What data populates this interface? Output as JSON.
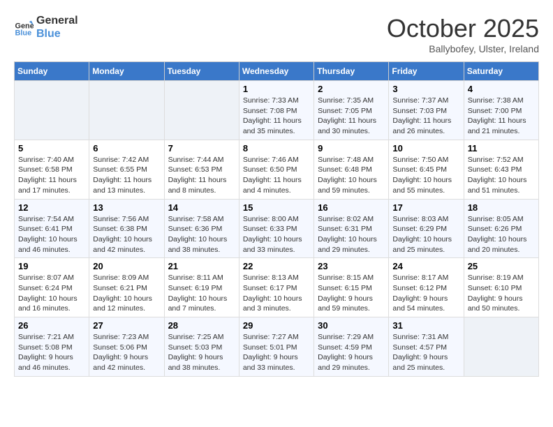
{
  "logo": {
    "line1": "General",
    "line2": "Blue"
  },
  "title": "October 2025",
  "location": "Ballybofey, Ulster, Ireland",
  "weekdays": [
    "Sunday",
    "Monday",
    "Tuesday",
    "Wednesday",
    "Thursday",
    "Friday",
    "Saturday"
  ],
  "rows": [
    [
      {
        "day": "",
        "info": ""
      },
      {
        "day": "",
        "info": ""
      },
      {
        "day": "",
        "info": ""
      },
      {
        "day": "1",
        "info": "Sunrise: 7:33 AM\nSunset: 7:08 PM\nDaylight: 11 hours\nand 35 minutes."
      },
      {
        "day": "2",
        "info": "Sunrise: 7:35 AM\nSunset: 7:05 PM\nDaylight: 11 hours\nand 30 minutes."
      },
      {
        "day": "3",
        "info": "Sunrise: 7:37 AM\nSunset: 7:03 PM\nDaylight: 11 hours\nand 26 minutes."
      },
      {
        "day": "4",
        "info": "Sunrise: 7:38 AM\nSunset: 7:00 PM\nDaylight: 11 hours\nand 21 minutes."
      }
    ],
    [
      {
        "day": "5",
        "info": "Sunrise: 7:40 AM\nSunset: 6:58 PM\nDaylight: 11 hours\nand 17 minutes."
      },
      {
        "day": "6",
        "info": "Sunrise: 7:42 AM\nSunset: 6:55 PM\nDaylight: 11 hours\nand 13 minutes."
      },
      {
        "day": "7",
        "info": "Sunrise: 7:44 AM\nSunset: 6:53 PM\nDaylight: 11 hours\nand 8 minutes."
      },
      {
        "day": "8",
        "info": "Sunrise: 7:46 AM\nSunset: 6:50 PM\nDaylight: 11 hours\nand 4 minutes."
      },
      {
        "day": "9",
        "info": "Sunrise: 7:48 AM\nSunset: 6:48 PM\nDaylight: 10 hours\nand 59 minutes."
      },
      {
        "day": "10",
        "info": "Sunrise: 7:50 AM\nSunset: 6:45 PM\nDaylight: 10 hours\nand 55 minutes."
      },
      {
        "day": "11",
        "info": "Sunrise: 7:52 AM\nSunset: 6:43 PM\nDaylight: 10 hours\nand 51 minutes."
      }
    ],
    [
      {
        "day": "12",
        "info": "Sunrise: 7:54 AM\nSunset: 6:41 PM\nDaylight: 10 hours\nand 46 minutes."
      },
      {
        "day": "13",
        "info": "Sunrise: 7:56 AM\nSunset: 6:38 PM\nDaylight: 10 hours\nand 42 minutes."
      },
      {
        "day": "14",
        "info": "Sunrise: 7:58 AM\nSunset: 6:36 PM\nDaylight: 10 hours\nand 38 minutes."
      },
      {
        "day": "15",
        "info": "Sunrise: 8:00 AM\nSunset: 6:33 PM\nDaylight: 10 hours\nand 33 minutes."
      },
      {
        "day": "16",
        "info": "Sunrise: 8:02 AM\nSunset: 6:31 PM\nDaylight: 10 hours\nand 29 minutes."
      },
      {
        "day": "17",
        "info": "Sunrise: 8:03 AM\nSunset: 6:29 PM\nDaylight: 10 hours\nand 25 minutes."
      },
      {
        "day": "18",
        "info": "Sunrise: 8:05 AM\nSunset: 6:26 PM\nDaylight: 10 hours\nand 20 minutes."
      }
    ],
    [
      {
        "day": "19",
        "info": "Sunrise: 8:07 AM\nSunset: 6:24 PM\nDaylight: 10 hours\nand 16 minutes."
      },
      {
        "day": "20",
        "info": "Sunrise: 8:09 AM\nSunset: 6:21 PM\nDaylight: 10 hours\nand 12 minutes."
      },
      {
        "day": "21",
        "info": "Sunrise: 8:11 AM\nSunset: 6:19 PM\nDaylight: 10 hours\nand 7 minutes."
      },
      {
        "day": "22",
        "info": "Sunrise: 8:13 AM\nSunset: 6:17 PM\nDaylight: 10 hours\nand 3 minutes."
      },
      {
        "day": "23",
        "info": "Sunrise: 8:15 AM\nSunset: 6:15 PM\nDaylight: 9 hours\nand 59 minutes."
      },
      {
        "day": "24",
        "info": "Sunrise: 8:17 AM\nSunset: 6:12 PM\nDaylight: 9 hours\nand 54 minutes."
      },
      {
        "day": "25",
        "info": "Sunrise: 8:19 AM\nSunset: 6:10 PM\nDaylight: 9 hours\nand 50 minutes."
      }
    ],
    [
      {
        "day": "26",
        "info": "Sunrise: 7:21 AM\nSunset: 5:08 PM\nDaylight: 9 hours\nand 46 minutes."
      },
      {
        "day": "27",
        "info": "Sunrise: 7:23 AM\nSunset: 5:06 PM\nDaylight: 9 hours\nand 42 minutes."
      },
      {
        "day": "28",
        "info": "Sunrise: 7:25 AM\nSunset: 5:03 PM\nDaylight: 9 hours\nand 38 minutes."
      },
      {
        "day": "29",
        "info": "Sunrise: 7:27 AM\nSunset: 5:01 PM\nDaylight: 9 hours\nand 33 minutes."
      },
      {
        "day": "30",
        "info": "Sunrise: 7:29 AM\nSunset: 4:59 PM\nDaylight: 9 hours\nand 29 minutes."
      },
      {
        "day": "31",
        "info": "Sunrise: 7:31 AM\nSunset: 4:57 PM\nDaylight: 9 hours\nand 25 minutes."
      },
      {
        "day": "",
        "info": ""
      }
    ]
  ]
}
